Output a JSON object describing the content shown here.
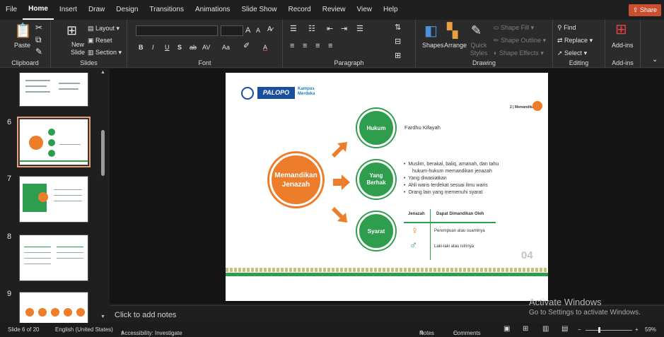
{
  "menu": {
    "items": [
      "File",
      "Home",
      "Insert",
      "Draw",
      "Design",
      "Transitions",
      "Animations",
      "Slide Show",
      "Record",
      "Review",
      "View",
      "Help"
    ],
    "active_index": 1,
    "share_label": "Share"
  },
  "ribbon": {
    "clipboard": {
      "label": "Clipboard",
      "paste": "Paste"
    },
    "slides": {
      "label": "Slides",
      "new_slide": "New Slide",
      "layout": "Layout",
      "reset": "Reset",
      "section": "Section"
    },
    "font": {
      "label": "Font",
      "size_up": "A",
      "size_down": "A",
      "bold": "B",
      "italic": "I",
      "underline": "U",
      "shadow": "S",
      "strike": "ab",
      "spacing": "AV",
      "case": "Aa"
    },
    "paragraph": {
      "label": "Paragraph"
    },
    "drawing": {
      "label": "Drawing",
      "shapes": "Shapes",
      "arrange": "Arrange",
      "quick_styles": "Quick Styles",
      "shape_fill": "Shape Fill",
      "shape_outline": "Shape Outline",
      "shape_effects": "Shape Effects"
    },
    "editing": {
      "label": "Editing",
      "find": "Find",
      "replace": "Replace",
      "select": "Select"
    },
    "addins": {
      "label": "Add-ins",
      "addins_btn": "Add-ins"
    }
  },
  "thumbnails": {
    "numbers": [
      "6",
      "7",
      "8",
      "9"
    ],
    "selected": "6"
  },
  "slide": {
    "logo_text": "PALOPO",
    "kampus": "Kampus Merdeka",
    "page_tag": "2 | Memandikan",
    "main_circle": "Memandikan Jenazah",
    "circles": [
      "Hukum",
      "Yang Berhak",
      "Syarat"
    ],
    "hukum_text": "Fardhu Kifayah",
    "yang_berhak_bullets": [
      "Muslim, berakal, baliq, amanah, dan tahu",
      "hukum-hukum memandikan jenazah",
      "Yang diwasiatkan",
      "Ahli waris terdekat sesuai ilmu waris",
      "Orang lain yang memenuhi syarat"
    ],
    "table": {
      "headers": [
        "Jenazah",
        "Dapat Dimandikan Oleh"
      ],
      "rows": [
        "Perempuan atau suaminya",
        "Laki-laki atau istrinya"
      ]
    },
    "slide_number": "04",
    "colors": {
      "green": "#2e9e4e",
      "orange": "#ee7d2b"
    }
  },
  "notes": {
    "placeholder": "Click to add notes"
  },
  "watermark": {
    "title": "Activate Windows",
    "subtitle": "Go to Settings to activate Windows."
  },
  "status": {
    "slide_info": "Slide 6 of 20",
    "language": "English (United States)",
    "accessibility": "Accessibility: Investigate",
    "notes_btn": "Notes",
    "comments_btn": "Comments",
    "zoom": "59%"
  }
}
